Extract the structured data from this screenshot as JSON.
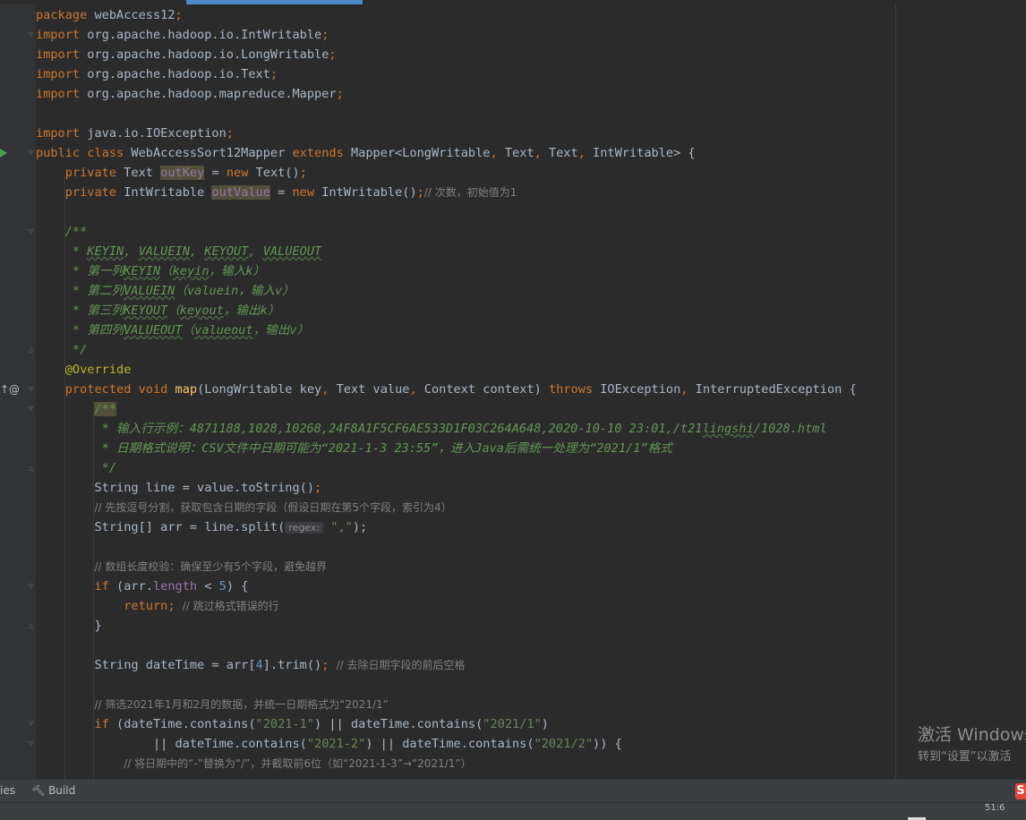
{
  "editor": {
    "lines": {
      "l1": [
        "package",
        " webAccess12",
        ";"
      ],
      "l2": [
        "import",
        " org.apache.hadoop.io.IntWritable",
        ";"
      ],
      "l3": [
        "import",
        " org.apache.hadoop.io.LongWritable",
        ";"
      ],
      "l4": [
        "import",
        " org.apache.hadoop.io.Text",
        ";"
      ],
      "l5": [
        "import",
        " org.apache.hadoop.mapreduce.Mapper",
        ";"
      ],
      "l7": [
        "import",
        " java.io.IOException",
        ";"
      ],
      "l8": [
        "public class",
        " WebAccessSort12Mapper ",
        "extends",
        " Mapper<LongWritable",
        ",",
        " Text",
        ",",
        " Text",
        ",",
        " IntWritable> {"
      ],
      "l9": [
        "    ",
        "private",
        " Text ",
        "outKey",
        " = ",
        "new",
        " Text()",
        ";"
      ],
      "l10": [
        "    ",
        "private",
        " IntWritable ",
        "outValue",
        " = ",
        "new",
        " IntWritable()",
        ";",
        "// 次数，初始值为1"
      ],
      "l12": "    /**",
      "l13": [
        "     * ",
        "KEYIN",
        ", ",
        "VALUEIN",
        ", ",
        "KEYOUT",
        ", ",
        "VALUEOUT"
      ],
      "l14": [
        "     * 第一列",
        "KEYIN",
        "（",
        "keyin",
        "，输入k）"
      ],
      "l15": [
        "     * 第二列",
        "VALUEIN",
        "（valuein，输入v）"
      ],
      "l16": [
        "     * 第三列",
        "KEYOUT",
        "（",
        "keyout",
        "，输出k）"
      ],
      "l17": [
        "     * 第四列",
        "VALUEOUT",
        "（",
        "valueout",
        "，输出v）"
      ],
      "l18": "     */",
      "l19": [
        "    ",
        "@Override"
      ],
      "l20": [
        "    ",
        "protected void",
        " ",
        "map",
        "(LongWritable key",
        ",",
        " Text value",
        ",",
        " Context context) ",
        "throws",
        " IOException",
        ",",
        " InterruptedException {"
      ],
      "l21": [
        "        ",
        "/**"
      ],
      "l22": [
        "         * 输入行示例：4871188,1028,10268,24F8A1F5CF6AE533D1F03C264A648,2020-10-10 23:01,/t21",
        "lingshi",
        "/1028.html"
      ],
      "l23": "         * 日期格式说明：CSV文件中日期可能为“2021-1-3 23:55”，进入Java后需统一处理为“2021/1”格式",
      "l24": "         */",
      "l25": [
        "        String line = value.toString()",
        ";"
      ],
      "l26": [
        "        ",
        "// 先按逗号分割，获取包含日期的字段（假设日期在第5个字段，索引为4）"
      ],
      "l27": [
        "        String[] arr = line.split(",
        "regex:",
        " \",\"",
        ");"
      ],
      "l29": [
        "        ",
        "// 数组长度校验：确保至少有5个字段，避免越界"
      ],
      "l30": [
        "        ",
        "if",
        " (arr.",
        "length",
        " < ",
        "5",
        ") {"
      ],
      "l31": [
        "            ",
        "return;",
        " ",
        "// 跳过格式错误的行"
      ],
      "l32": "        }",
      "l34": [
        "        String dateTime = arr[",
        "4",
        "].trim()",
        ";",
        " ",
        "// 去除日期字段的前后空格"
      ],
      "l36": [
        "        ",
        "// 筛选2021年1月和2月的数据，并统一日期格式为“2021/1”"
      ],
      "l37": [
        "        ",
        "if",
        " (dateTime.contains(",
        "\"2021-1\"",
        ") || dateTime.contains(",
        "\"2021/1\"",
        ")"
      ],
      "l38": [
        "                || dateTime.contains(",
        "\"2021-2\"",
        ") || dateTime.contains(",
        "\"2021/2\"",
        ")) {"
      ],
      "l39": [
        "            ",
        "// 将日期中的“-”替换为“/”，并截取前6位（如“2021-1-3”→“2021/1”）"
      ]
    }
  },
  "toolbar": {
    "partial_label": "ies",
    "build_label": "Build"
  },
  "watermark": {
    "title": "激活 Windows",
    "subtitle": "转到“设置”以激活"
  },
  "status": {
    "position": "51:6"
  },
  "colors": {
    "background": "#2b2b2b",
    "keyword": "#cc7832",
    "string": "#6a8759",
    "number": "#6897bb",
    "doc_comment": "#629755",
    "annotation": "#bbb529"
  }
}
